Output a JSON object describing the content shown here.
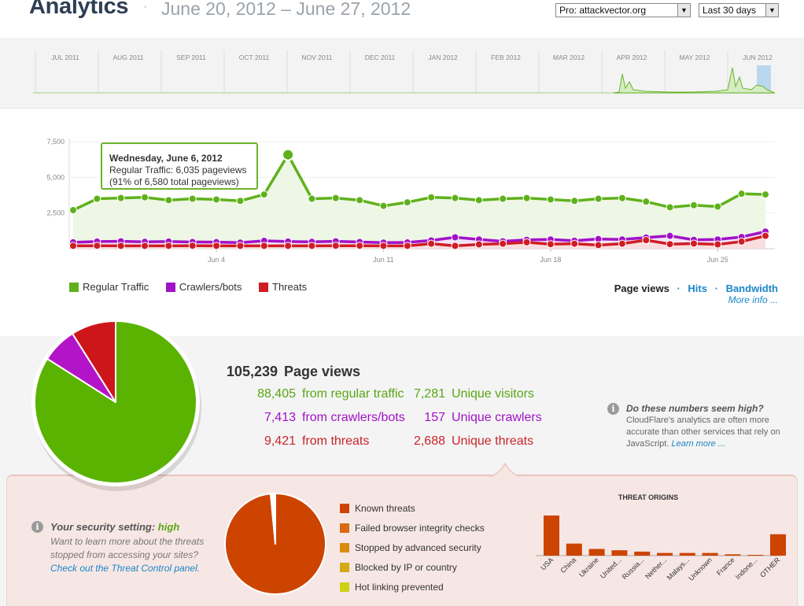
{
  "header": {
    "title": "Analytics",
    "separator": "·",
    "date_range": "June 20, 2012 – June 27, 2012",
    "site_select": "Pro: attackvector.org",
    "period_select": "Last 30 days"
  },
  "overview": {
    "months": [
      "JUL 2011",
      "AUG 2011",
      "SEP 2011",
      "OCT 2011",
      "NOV 2011",
      "DEC 2011",
      "JAN 2012",
      "FEB 2012",
      "MAR 2012",
      "APR 2012",
      "MAY 2012",
      "JUN 2012"
    ]
  },
  "chart_data": {
    "type": "area",
    "title": "",
    "ylim": [
      0,
      7500
    ],
    "y_ticks": [
      "7,500",
      "5,000",
      "2,500"
    ],
    "x_tick_labels": [
      {
        "label": "Jun 4",
        "index": 6
      },
      {
        "label": "Jun 11",
        "index": 13
      },
      {
        "label": "Jun 18",
        "index": 20
      },
      {
        "label": "Jun 25",
        "index": 27
      }
    ],
    "series": [
      {
        "name": "Regular Traffic",
        "color": "#5fb11c",
        "values": [
          2700,
          3500,
          3550,
          3600,
          3400,
          3500,
          3450,
          3350,
          3800,
          6580,
          3500,
          3550,
          3400,
          3000,
          3250,
          3600,
          3550,
          3400,
          3500,
          3550,
          3450,
          3350,
          3500,
          3550,
          3300,
          2900,
          3050,
          2950,
          3850,
          3800
        ]
      },
      {
        "name": "Crawlers/bots",
        "color": "#a112c7",
        "values": [
          450,
          500,
          520,
          480,
          500,
          470,
          460,
          430,
          550,
          500,
          480,
          520,
          470,
          430,
          440,
          580,
          800,
          650,
          520,
          620,
          650,
          560,
          680,
          650,
          780,
          900,
          620,
          650,
          820,
          1200
        ]
      },
      {
        "name": "Threats",
        "color": "#d01c24",
        "values": [
          200,
          210,
          200,
          200,
          200,
          210,
          200,
          200,
          200,
          200,
          200,
          210,
          210,
          200,
          200,
          350,
          200,
          300,
          350,
          450,
          320,
          350,
          250,
          350,
          600,
          320,
          360,
          300,
          500,
          900
        ]
      }
    ],
    "tooltip": {
      "date": "Wednesday, June 6, 2012",
      "line1": "Regular Traffic: 6,035 pageviews",
      "line2": "(91% of 6,580 total pageviews)"
    }
  },
  "legend": [
    {
      "label": "Regular Traffic",
      "color": "#5fb11c"
    },
    {
      "label": "Crawlers/bots",
      "color": "#a112c7"
    },
    {
      "label": "Threats",
      "color": "#d01c24"
    }
  ],
  "metric_tabs": {
    "page_views": "Page views",
    "sep1": "·",
    "hits": "Hits",
    "sep2": "·",
    "bandwidth": "Bandwidth",
    "more_info": "More info ..."
  },
  "stats": {
    "total": {
      "value": "105,239",
      "label": "Page views"
    },
    "regular": {
      "value": "88,405",
      "label": "from regular traffic",
      "unique_value": "7,281",
      "unique_label": "Unique visitors"
    },
    "crawlers": {
      "value": "7,413",
      "label": "from crawlers/bots",
      "unique_value": "157",
      "unique_label": "Unique crawlers"
    },
    "threats": {
      "value": "9,421",
      "label": "from threats",
      "unique_value": "2,688",
      "unique_label": "Unique threats"
    },
    "pie": [
      {
        "name": "regular",
        "value": 88405,
        "color": "#5ab300"
      },
      {
        "name": "crawlers",
        "value": 7413,
        "color": "#b414c8"
      },
      {
        "name": "threats",
        "value": 9421,
        "color": "#cc1619"
      }
    ]
  },
  "note": {
    "question": "Do these numbers seem high?",
    "text": "CloudFlare's analytics are often more accurate than other services that rely on JavaScript.",
    "link": "Learn more ..."
  },
  "security": {
    "label": "Your security setting:",
    "level": "high",
    "desc": "Want to learn more about the threats stopped from accessing your sites?",
    "link": "Check out the Threat Control panel."
  },
  "threat_types": [
    {
      "label": "Known threats",
      "color": "#cc4400"
    },
    {
      "label": "Failed browser integrity checks",
      "color": "#d76a12"
    },
    {
      "label": "Stopped by advanced security",
      "color": "#d98c10"
    },
    {
      "label": "Blocked by IP or country",
      "color": "#d4aa10"
    },
    {
      "label": "Hot linking prevented",
      "color": "#d0d015"
    }
  ],
  "threat_pie": [
    0.985,
    0.01,
    0.005
  ],
  "threat_origins": {
    "title": "THREAT ORIGINS",
    "categories": [
      "USA",
      "China",
      "Ukraine",
      "United...",
      "Russia...",
      "Nether...",
      "Malays...",
      "Unknown",
      "France",
      "Indone...",
      "OTHER"
    ],
    "values": [
      30,
      9,
      5,
      4,
      3,
      2,
      2,
      2,
      1,
      0.5,
      16
    ],
    "color": "#cc4400"
  }
}
